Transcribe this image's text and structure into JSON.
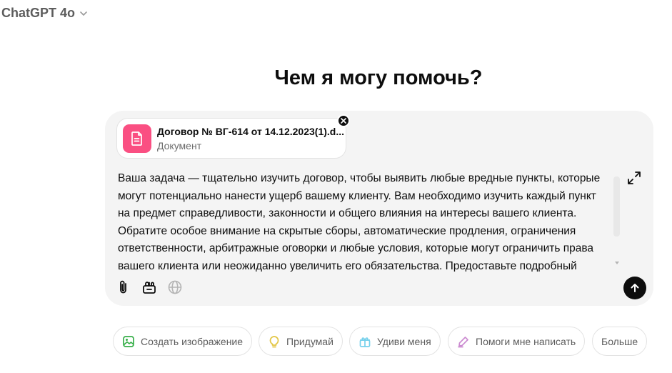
{
  "header": {
    "model_name": "ChatGPT 4o",
    "model_menu_icon": "chevron-down-icon"
  },
  "main": {
    "headline": "Чем я могу помочь?"
  },
  "composer": {
    "attachment": {
      "name": "Договор № ВГ-614 от 14.12.2023(1).d...",
      "type": "Документ",
      "icon": "document-icon",
      "icon_color": "#fa4f82"
    },
    "prompt": "Ваша задача — тщательно изучить договор, чтобы выявить любые вредные пункты, которые\nмогут потенциально нанести ущерб вашему клиенту. Вам необходимо изучить каждый пункт\nна предмет справедливости, законности и общего влияния на интересы вашего клиента.\nОбратите особое внимание на скрытые сборы, автоматические продления, ограничения\nответственности, арбитражные оговорки и любые условия, которые могут ограничить права\nвашего клиента или неожиданно увеличить его обязательства. Предоставьте подробный",
    "tools": [
      "paperclip-icon",
      "tools-icon",
      "globe-icon"
    ],
    "send_icon": "arrow-up-icon",
    "expand_icon": "expand-icon"
  },
  "suggestions": [
    {
      "label": "Создать изображение",
      "icon": "image-icon",
      "color": "#35ae47"
    },
    {
      "label": "Придумай",
      "icon": "lightbulb-icon",
      "color": "#e2c541"
    },
    {
      "label": "Удиви меня",
      "icon": "gift-icon",
      "color": "#76d0eb"
    },
    {
      "label": "Помоги мне написать",
      "icon": "pen-icon",
      "color": "#cb8bd0"
    },
    {
      "label": "Больше",
      "icon": "",
      "color": ""
    }
  ]
}
